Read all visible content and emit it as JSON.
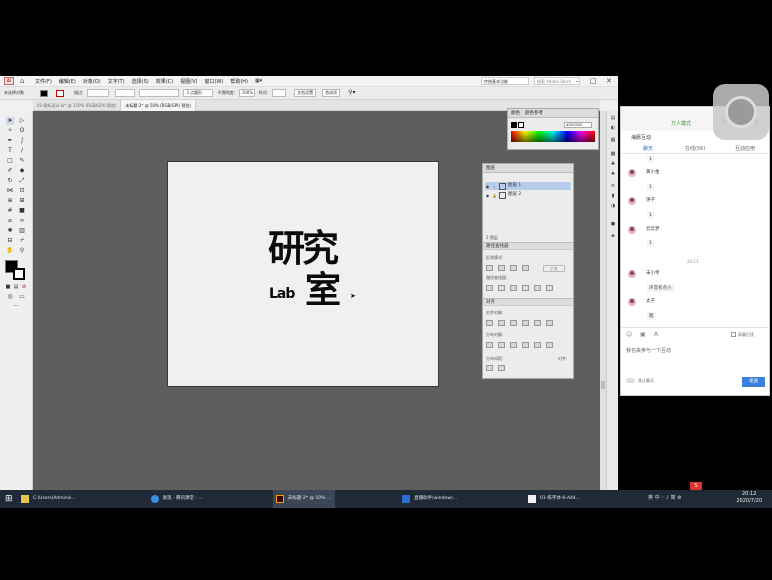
{
  "app": {
    "logo": "Ai",
    "menu": [
      "文件(F)",
      "编辑(E)",
      "对象(O)",
      "文字(T)",
      "选择(S)",
      "效果(C)",
      "视图(V)",
      "窗口(W)",
      "帮助(H)"
    ],
    "workspace": "传统基本功能",
    "search_placeholder": "搜索 Adobe Stock"
  },
  "control_bar": {
    "selection_label": "未选择对象",
    "stroke_label": "描边:",
    "stroke_width": "3 点圆形",
    "opacity_label": "不透明度:",
    "opacity_value": "100%",
    "style_label": "样式:",
    "doc_setup": "文档设置",
    "preferences": "首选项"
  },
  "tabs": [
    {
      "label": "02-图标设计.ai* @ 150% (RGB/GPU 预览)"
    },
    {
      "label": "未标题-2* @ 50% (RGB/GPU 预览)"
    }
  ],
  "artboard": {
    "logo_line1": "研究",
    "logo_lab": "Lab",
    "logo_line2": "室"
  },
  "color_panel": {
    "tab1": "颜色",
    "tab2": "颜色参考",
    "hex": "#000000"
  },
  "layers_panel": {
    "title": "图层",
    "layers": [
      {
        "name": "图层 1"
      },
      {
        "name": "图层 2"
      }
    ],
    "count": "2 图层",
    "pathfinder": {
      "title": "路径查找器",
      "shape_modes": "形状模式:",
      "expand": "扩展",
      "pathfinders": "路径查找器:"
    },
    "align": {
      "title": "对齐",
      "align_objects": "对齐对象:",
      "distribute_objects": "分布对象:",
      "distribute_spacing": "分布间距:",
      "align_to": "对齐:"
    }
  },
  "chat": {
    "title": "海豚互动",
    "signal": "万人模式",
    "tabs": [
      "聊天",
      "在线(56)",
      "互动应用"
    ],
    "messages": [
      {
        "name": "",
        "text": "1"
      },
      {
        "name": "黄小金",
        "text": "1"
      },
      {
        "name": "饼子",
        "text": "1"
      },
      {
        "name": "云云梦",
        "text": "1"
      }
    ],
    "time": "20:11",
    "messages2": [
      {
        "name": "未小禾",
        "text": "声音有点小"
      },
      {
        "name": "太子",
        "text": "嗯"
      }
    ],
    "mute_label": "屏蔽打扰",
    "input_placeholder": "我也来参与一下互动",
    "ban_label": "禁止聊天",
    "send": "发送"
  },
  "taskbar": {
    "items": [
      {
        "label": "C:\\Users\\Adminis..."
      },
      {
        "label": "发现 - 腾讯课堂 - ..."
      },
      {
        "label": "未标题-2* @ 50% ..."
      },
      {
        "label": "直播助手(window)..."
      },
      {
        "label": "01-练字体-6-A44..."
      }
    ],
    "tray": "英 中 ◦ ♪ 简 ⚙",
    "time": "20:12",
    "date": "2020/7/20"
  }
}
